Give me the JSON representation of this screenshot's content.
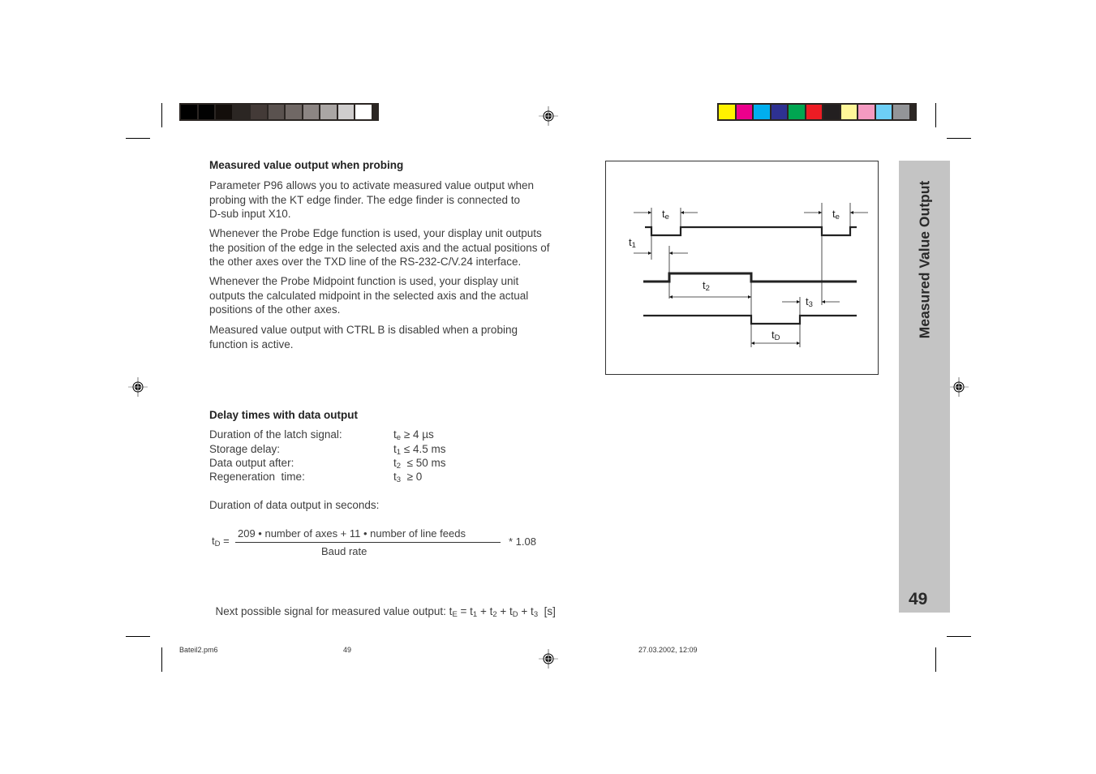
{
  "printer_marks": {
    "grayscale_swatches": [
      "#000000",
      "#020202",
      "#130e0b",
      "#2b2623",
      "#433a37",
      "#5a524f",
      "#706865",
      "#8c8583",
      "#aaa6a4",
      "#cfcdcd",
      "#ffffff"
    ],
    "color_swatches": [
      "#fff200",
      "#ec008c",
      "#00aeef",
      "#2e3192",
      "#00a651",
      "#ed1c24",
      "#231f20",
      "#fff799",
      "#f49ac1",
      "#6dcff6",
      "#939598"
    ]
  },
  "section1": {
    "heading": "Measured value output when probing",
    "paragraphs": [
      [
        "Parameter P96 allows you to activate measured value output when",
        "probing with the KT edge finder. The edge finder is connected to",
        "D-sub input X10."
      ],
      [
        "Whenever the Probe Edge function is used, your display unit outputs",
        "the position of the edge in the selected axis and the actual positions of",
        "the other axes over the TXD line of the RS-232-C/V.24 interface."
      ],
      [
        "Whenever the Probe Midpoint function is used, your display unit",
        "outputs the calculated midpoint in the selected axis and the actual",
        "positions of the other axes."
      ],
      [
        "Measured value output with CTRL B is disabled when a probing",
        "function is active."
      ]
    ]
  },
  "diagram": {
    "labels": {
      "te_left": {
        "base": "t",
        "sub": "e"
      },
      "te_right": {
        "base": "t",
        "sub": "e"
      },
      "t1": {
        "base": "t",
        "sub": "1"
      },
      "t2": {
        "base": "t",
        "sub": "2"
      },
      "t3": {
        "base": "t",
        "sub": "3"
      },
      "tD": {
        "base": "t",
        "sub": "D"
      }
    }
  },
  "section2": {
    "heading": "Delay times with data output",
    "rows": [
      {
        "label": "Duration of the latch signal:",
        "sym": "t",
        "sub": "e",
        "value": " ≥ 4 µs"
      },
      {
        "label": "Storage delay:",
        "sym": "t",
        "sub": "1",
        "value": " ≤ 4.5 ms"
      },
      {
        "label": "Data output after:",
        "sym": "t",
        "sub": "2",
        "value": "  ≤ 50 ms"
      },
      {
        "label": "Regeneration  time:",
        "sym": "t",
        "sub": "3",
        "value": "  ≥ 0"
      }
    ],
    "duration_label": "Duration of data output in seconds:",
    "formula": {
      "lhs_base": "t",
      "lhs_sub": "D",
      "equals": " =",
      "numerator": "209 • number of axes + 11 • number of line feeds",
      "denominator": "Baud rate",
      "factor": "* 1.08"
    },
    "next_signal": {
      "prefix": "Next possible signal for measured value output: t",
      "sub_E": "E",
      "eq": " = t",
      "sub_1": "1",
      "plus2": " + t",
      "sub_2": "2",
      "plusD": " + t",
      "sub_D": "D",
      "plus3": " + t",
      "sub_3": "3",
      "unit": "  [s]"
    }
  },
  "sidebar": {
    "title": "Measured Value Output",
    "page_number": "49"
  },
  "footer": {
    "filename": "Bateil2.pm6",
    "page": "49",
    "timestamp": "27.03.2002, 12:09"
  }
}
